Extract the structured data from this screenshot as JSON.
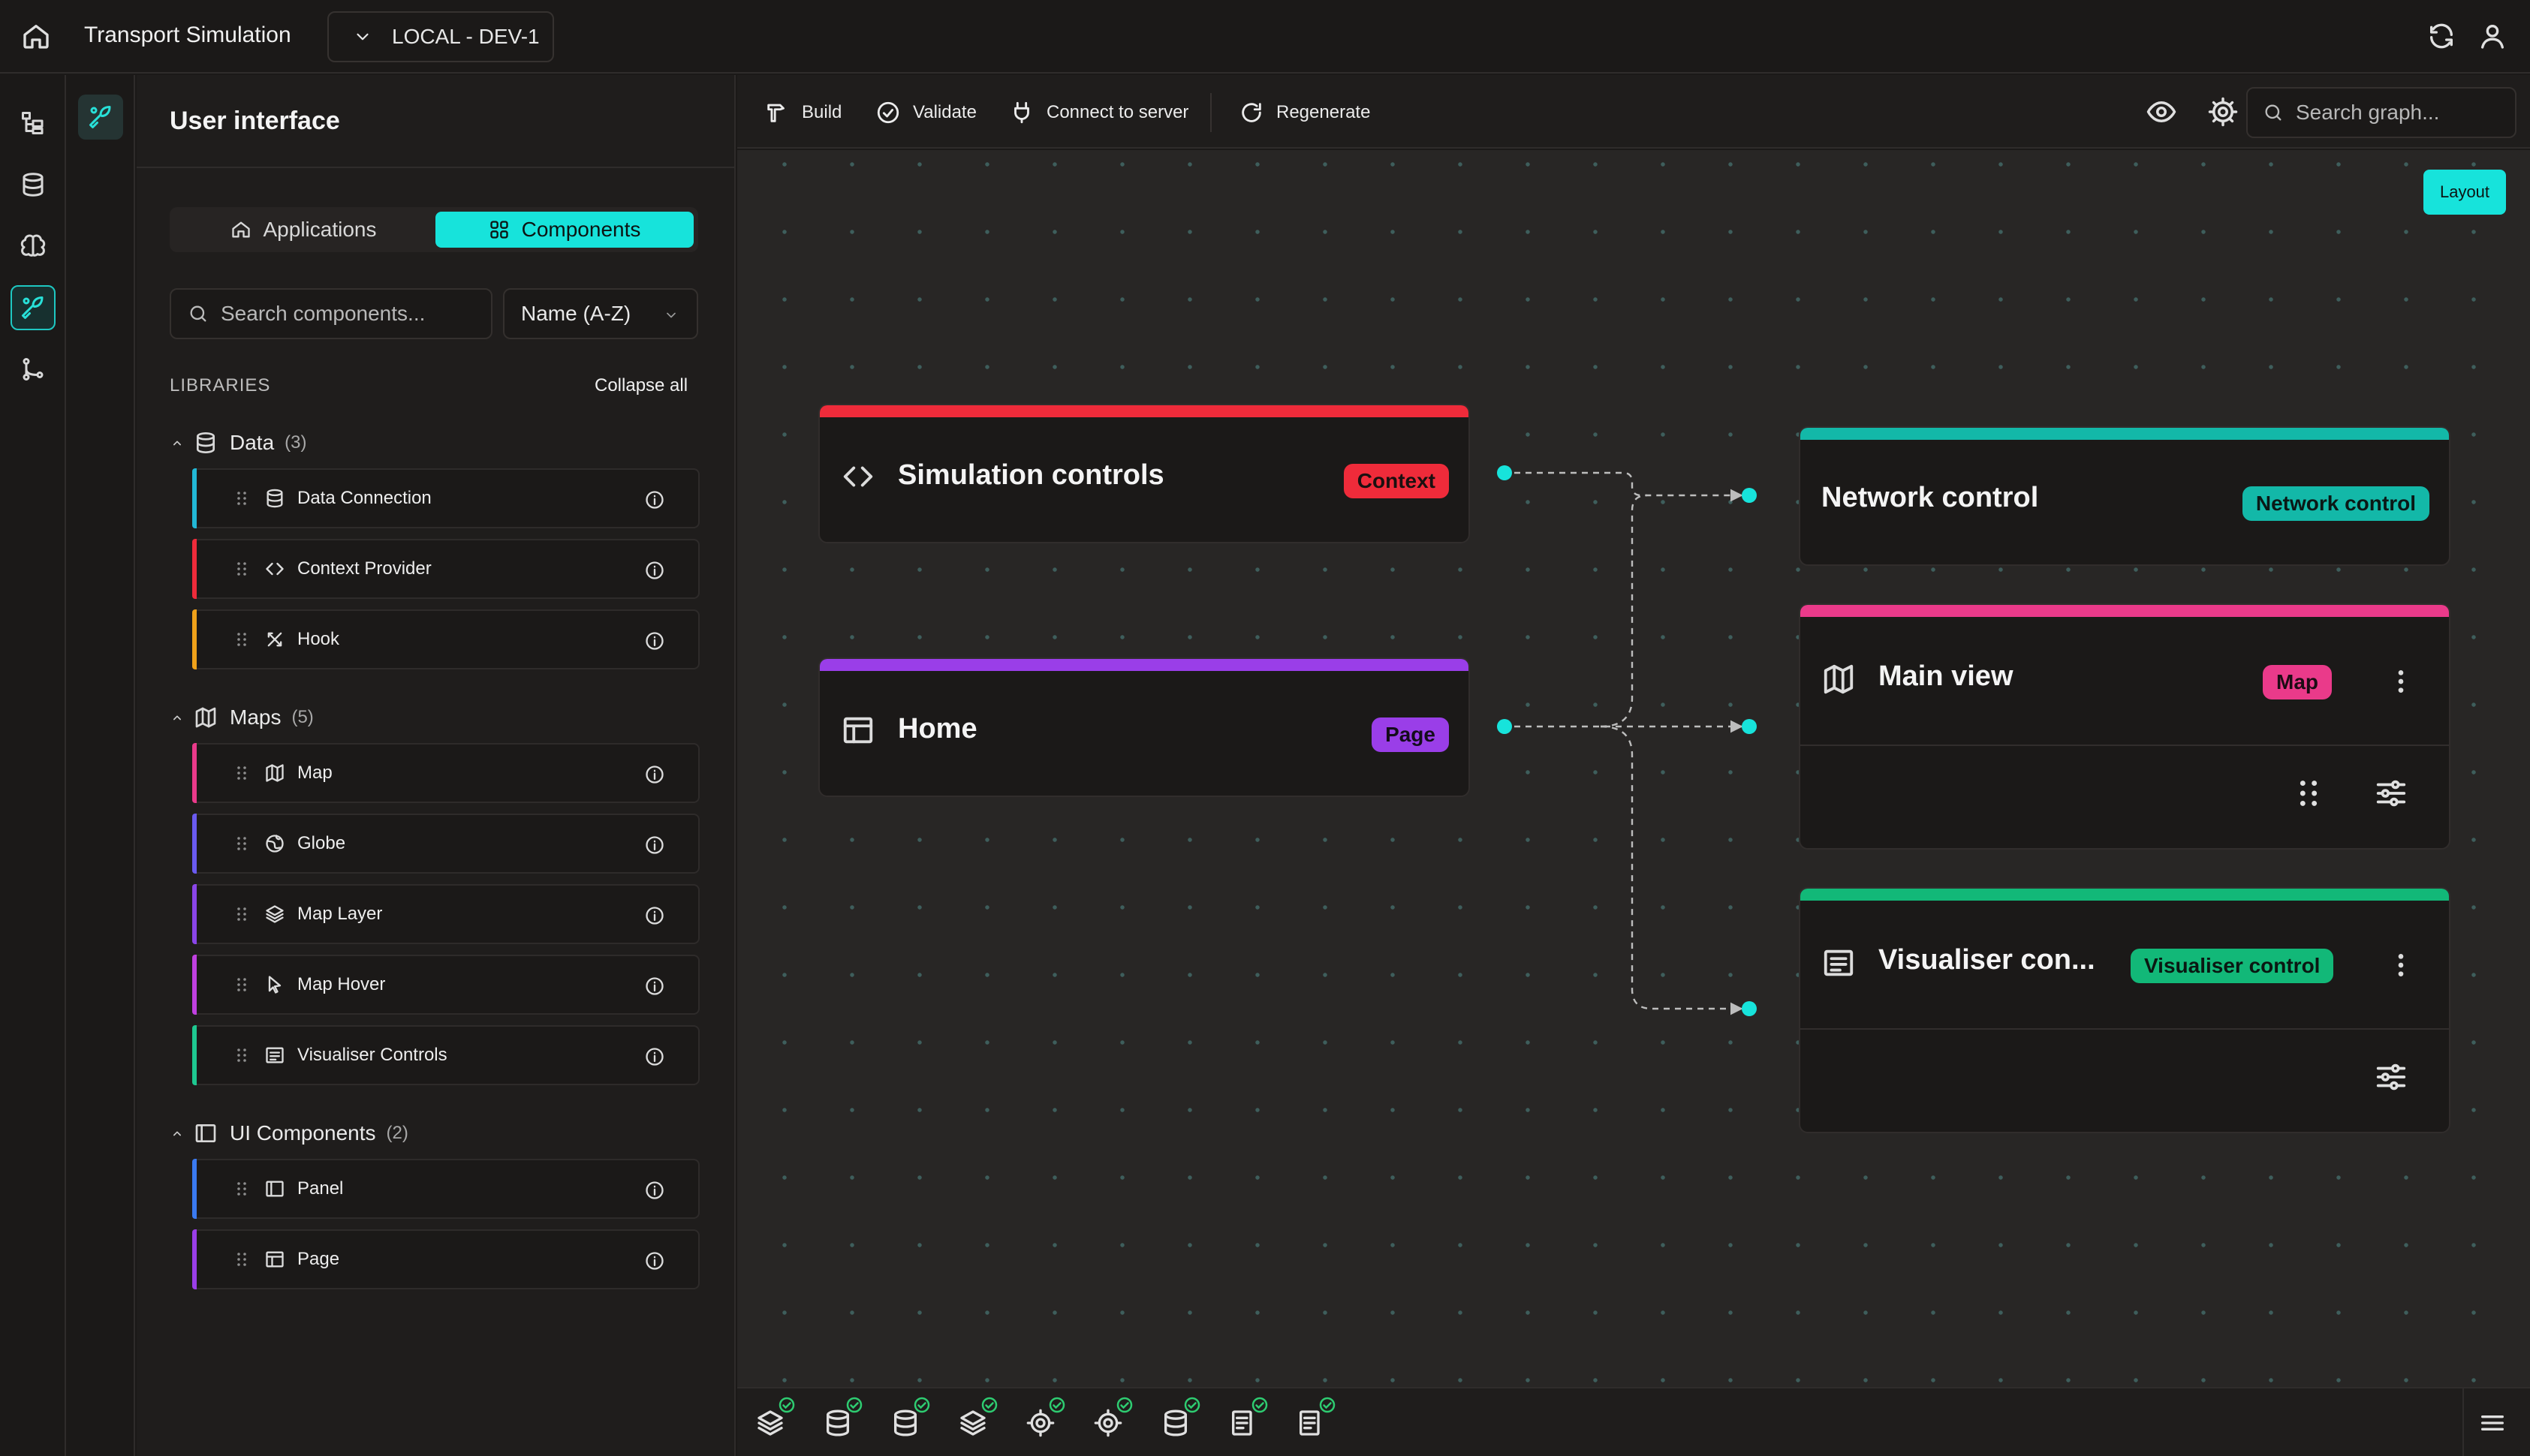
{
  "app": {
    "title": "Transport Simulation",
    "environment": "LOCAL - DEV-1"
  },
  "panel": {
    "title": "User interface",
    "tabs": {
      "applications": "Applications",
      "components": "Components",
      "active": "Components"
    },
    "search_placeholder": "Search components...",
    "sort": "Name (A-Z)",
    "libraries_label": "LIBRARIES",
    "collapse_all": "Collapse all",
    "groups": [
      {
        "name": "Data",
        "count": "(3)",
        "icon": "database-icon",
        "items": [
          {
            "label": "Data Connection",
            "icon": "database-icon",
            "color": "#22b8d6"
          },
          {
            "label": "Context Provider",
            "icon": "code-icon",
            "color": "#ef2b3a"
          },
          {
            "label": "Hook",
            "icon": "hook-icon",
            "color": "#f0a21a"
          }
        ]
      },
      {
        "name": "Maps",
        "count": "(5)",
        "icon": "map-icon",
        "items": [
          {
            "label": "Map",
            "icon": "map-icon",
            "color": "#ea3a8a"
          },
          {
            "label": "Globe",
            "icon": "globe-icon",
            "color": "#6a5af0"
          },
          {
            "label": "Map Layer",
            "icon": "layers-icon",
            "color": "#8a45e8"
          },
          {
            "label": "Map Hover",
            "icon": "pointer-icon",
            "color": "#c040e0"
          },
          {
            "label": "Visualiser Controls",
            "icon": "controls-icon",
            "color": "#1ec890"
          }
        ]
      },
      {
        "name": "UI Components",
        "count": "(2)",
        "icon": "panel-icon",
        "items": [
          {
            "label": "Panel",
            "icon": "panel-icon",
            "color": "#3a7af0"
          },
          {
            "label": "Page",
            "icon": "page-icon",
            "color": "#9a3ee8"
          }
        ]
      }
    ]
  },
  "toolbar": {
    "build": "Build",
    "validate": "Validate",
    "connect": "Connect to server",
    "regenerate": "Regenerate",
    "search_placeholder": "Search graph..."
  },
  "canvas": {
    "layout_button": "Layout",
    "nodes": {
      "simulation_controls": {
        "title": "Simulation controls",
        "badge": "Context",
        "color": "#ef2b3a"
      },
      "home": {
        "title": "Home",
        "badge": "Page",
        "color": "#9a3ee8"
      },
      "network_control": {
        "title": "Network control",
        "badge": "Network control",
        "color": "#13b8a8"
      },
      "main_view": {
        "title": "Main view",
        "badge": "Map",
        "color": "#ea3a8a"
      },
      "visualiser_control": {
        "title": "Visualiser con...",
        "badge": "Visualiser control",
        "color": "#12b878"
      }
    }
  },
  "status_bar": {
    "icons": [
      "layers-icon",
      "database-icon",
      "database-icon",
      "layers-icon",
      "gear-icon",
      "gear-icon",
      "database-icon",
      "document-icon",
      "document-icon"
    ],
    "status": "all-valid"
  },
  "colors": {
    "accent": "#17e3db",
    "background": "#1b1918",
    "canvas": "#282625"
  }
}
